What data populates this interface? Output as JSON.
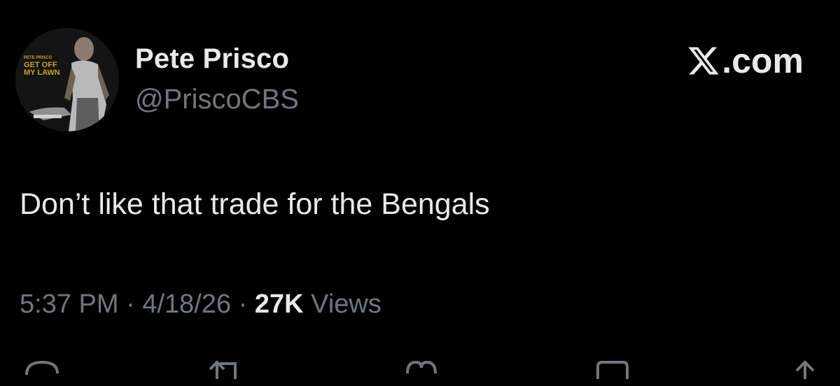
{
  "author": {
    "display_name": "Pete Prisco",
    "handle": "@PriscoCBS",
    "avatar": {
      "icon": "avatar-photo",
      "caption_top": "PETE PRISCO",
      "caption_line1": "GET OFF",
      "caption_line2": "MY LAWN",
      "caption_color": "#c9a227"
    }
  },
  "brand": {
    "label": ".com",
    "icon": "x-logo-icon"
  },
  "tweet": {
    "text": "Don’t like that trade for the Bengals"
  },
  "meta": {
    "time": "5:37 PM",
    "separator": "·",
    "date": "4/18/26",
    "views_count": "27K",
    "views_label": "Views"
  },
  "actions": [
    {
      "icon": "reply-icon"
    },
    {
      "icon": "repost-icon"
    },
    {
      "icon": "like-icon"
    },
    {
      "icon": "bookmark-icon"
    },
    {
      "icon": "share-icon"
    }
  ],
  "colors": {
    "background": "#000000",
    "primary_text": "#e7e9ea",
    "secondary_text": "#71767b"
  }
}
